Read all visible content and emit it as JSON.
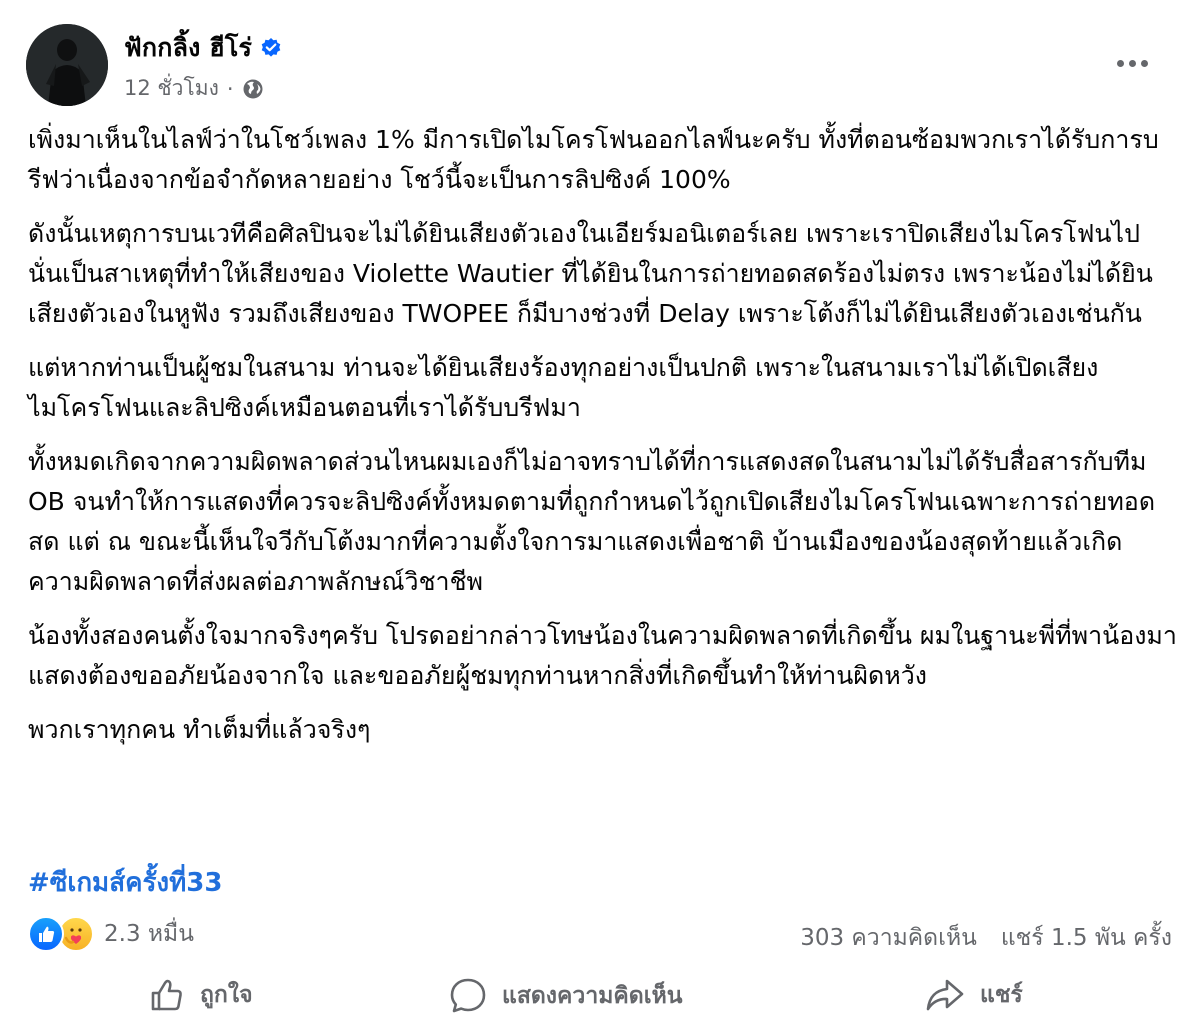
{
  "post": {
    "author": "ฟักกลิ้ง ฮีโร่",
    "time": "12 ชั่วโมง",
    "separator": "·",
    "paragraphs": [
      "เพิ่งมาเห็นในไลฟ์ว่าในโชว์เพลง 1% มีการเปิดไมโครโฟนออกไลฟ์นะครับ ทั้งที่ตอนซ้อมพวกเราได้รับการบรีฟว่าเนื่องจากข้อจำกัดหลายอย่าง โชว์นี้จะเป็นการลิปซิงค์ 100%",
      "ดังนั้นเหตุการบนเวทีคือศิลปินจะไม่ได้ยินเสียงตัวเองในเอียร์มอนิเตอร์เลย เพราะเราปิดเสียงไมโครโฟนไป นั่นเป็นสาเหตุที่ทำให้เสียงของ Violette Wautier ที่ได้ยินในการถ่ายทอดสดร้องไม่ตรง เพราะน้องไม่ได้ยินเสียงตัวเองในหูฟัง รวมถึงเสียงของ TWOPEE ก็มีบางช่วงที่ Delay เพราะโต้งก็ไม่ได้ยินเสียงตัวเองเช่นกัน",
      "แต่หากท่านเป็นผู้ชมในสนาม ท่านจะได้ยินเสียงร้องทุกอย่างเป็นปกติ เพราะในสนามเราไม่ได้เปิดเสียงไมโครโฟนและลิปซิงค์เหมือนตอนที่เราได้รับบรีฟมา",
      "ทั้งหมดเกิดจากความผิดพลาดส่วนไหนผมเองก็ไม่อาจทราบได้ที่การแสดงสดในสนามไม่ได้รับสื่อสารกับทีม OB จนทำให้การแสดงที่ควรจะลิปซิงค์ทั้งหมดตามที่ถูกกำหนดไว้ถูกเปิดเสียงไมโครโฟนเฉพาะการถ่ายทอดสด แต่ ณ ขณะนี้เห็นใจวีกับโต้งมากที่ความตั้งใจการมาแสดงเพื่อชาติ บ้านเมืองของน้องสุดท้ายแล้วเกิดความผิดพลาดที่ส่งผลต่อภาพลักษณ์วิชาชีพ",
      "น้องทั้งสองคนตั้งใจมากจริงๆครับ โปรดอย่ากล่าวโทษน้องในความผิดพลาดที่เกิดขึ้น ผมในฐานะพี่ที่พาน้องมาแสดงต้องขออภัยน้องจากใจ และขออภัยผู้ชมทุกท่านหากสิ่งที่เกิดขึ้นทำให้ท่านผิดหวัง",
      "พวกเราทุกคน ทำเต็มที่แล้วจริงๆ"
    ],
    "hashtag": "#ซีเกมส์ครั้งที่33"
  },
  "reactions": {
    "count": "2.3 หมื่น",
    "types": [
      "like-icon",
      "care-icon"
    ]
  },
  "stats": {
    "comments": "303 ความคิดเห็น",
    "shares": "แชร์ 1.5 พัน ครั้ง"
  },
  "actions": {
    "like": "ถูกใจ",
    "comment": "แสดงความคิดเห็น",
    "share": "แชร์"
  },
  "colors": {
    "hashtag": "#216fdb",
    "verified": "#0866ff",
    "secondary_text": "#65676b"
  }
}
